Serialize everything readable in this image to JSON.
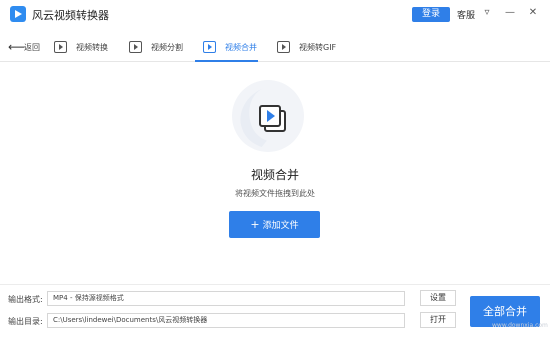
{
  "titlebar": {
    "app_title": "风云视频转换器",
    "login_label": "登录",
    "service_label": "客服",
    "menu_glyph": "▿",
    "minimize_glyph": "—",
    "close_glyph": "✕"
  },
  "tabbar": {
    "back_label": "返回",
    "tabs": [
      {
        "label": "视频转换",
        "icon": "video-convert-icon"
      },
      {
        "label": "视频分割",
        "icon": "video-split-icon"
      },
      {
        "label": "视频合并",
        "icon": "video-merge-icon",
        "active": true
      },
      {
        "label": "视频转GIF",
        "icon": "video-gif-icon"
      }
    ]
  },
  "main": {
    "title": "视频合并",
    "hint": "将视频文件拖拽到此处",
    "add_button_label": "添加文件"
  },
  "bottom": {
    "format_label": "输出格式:",
    "format_value": "MP4 - 保持源视频格式",
    "settings_label": "设置",
    "dir_label": "输出目录:",
    "dir_value": "C:\\Users\\lindewei\\Documents\\风云视频转换器",
    "open_label": "打开",
    "merge_all_label": "全部合并"
  },
  "watermark": "www.downxia.com",
  "colors": {
    "accent": "#2f7fe8"
  }
}
